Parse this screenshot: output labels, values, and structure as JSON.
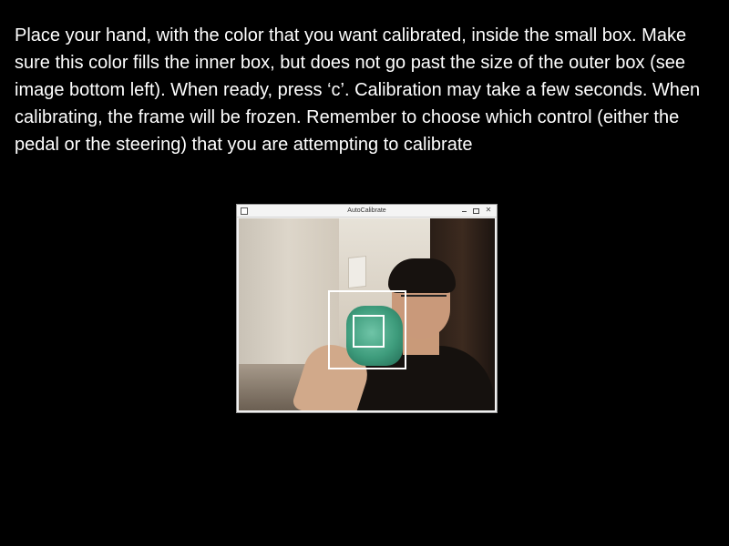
{
  "instructions": {
    "text": "Place your hand, with the color that you want calibrated, inside the small box. Make sure this color fills the inner box, but does not go past the size of the outer box (see image bottom left). When ready, press ‘c’. Calibration may take a few seconds. When calibrating, the frame will be frozen. Remember to choose which control (either the pedal or the steering) that you are attempting to calibrate"
  },
  "window": {
    "title": "AutoCalibrate",
    "minimize_glyph": "",
    "maximize_glyph": "",
    "close_glyph": "✕"
  },
  "colors": {
    "background": "#000000",
    "text": "#ffffff",
    "calibration_box": "#ffffff",
    "glove": "#3e9c7c"
  }
}
